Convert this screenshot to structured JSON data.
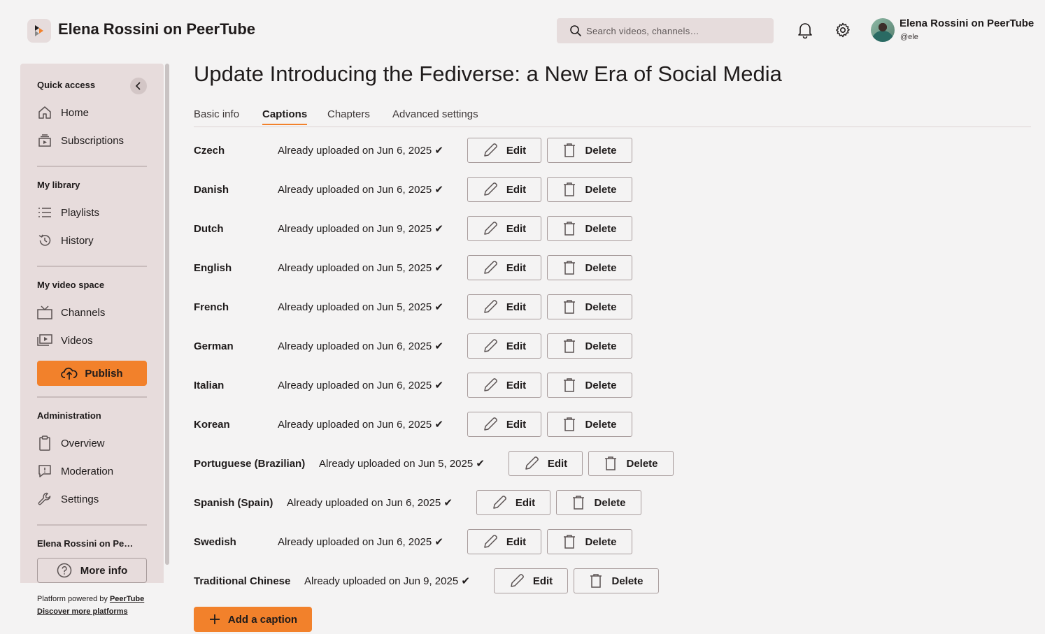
{
  "header": {
    "brand": "Elena Rossini on PeerTube",
    "search_placeholder": "Search videos, channels…",
    "user_name": "Elena Rossini on PeerTube",
    "user_handle": "@ele"
  },
  "sidebar": {
    "quick_access": "Quick access",
    "quick_items": [
      {
        "label": "Home",
        "icon": "home-icon"
      },
      {
        "label": "Subscriptions",
        "icon": "subscriptions-icon"
      }
    ],
    "my_library": "My library",
    "library_items": [
      {
        "label": "Playlists",
        "icon": "playlist-icon"
      },
      {
        "label": "History",
        "icon": "history-icon"
      }
    ],
    "my_video_space": "My video space",
    "space_items": [
      {
        "label": "Channels",
        "icon": "channel-icon"
      },
      {
        "label": "Videos",
        "icon": "videos-icon"
      }
    ],
    "publish": "Publish",
    "administration": "Administration",
    "admin_items": [
      {
        "label": "Overview",
        "icon": "clipboard-icon"
      },
      {
        "label": "Moderation",
        "icon": "moderation-icon"
      },
      {
        "label": "Settings",
        "icon": "wrench-icon"
      }
    ],
    "instance_title": "Elena Rossini on Pe…",
    "more_info": "More info",
    "powered_by": "Platform powered by ",
    "peertube_link": "PeerTube",
    "discover": "Discover more platforms"
  },
  "main": {
    "title": "Update Introducing the Fediverse: a New Era of Social Media",
    "tabs": [
      "Basic info",
      "Captions",
      "Chapters",
      "Advanced settings"
    ],
    "active_tab": "Captions",
    "edit_label": "Edit",
    "delete_label": "Delete",
    "add_caption": "Add a caption",
    "captions": [
      {
        "language": "Czech",
        "status": "Already uploaded on Jun 6, 2025 ✔"
      },
      {
        "language": "Danish",
        "status": "Already uploaded on Jun 6, 2025 ✔"
      },
      {
        "language": "Dutch",
        "status": "Already uploaded on Jun 9, 2025 ✔"
      },
      {
        "language": "English",
        "status": "Already uploaded on Jun 5, 2025 ✔"
      },
      {
        "language": "French",
        "status": "Already uploaded on Jun 5, 2025 ✔"
      },
      {
        "language": "German",
        "status": "Already uploaded on Jun 6, 2025 ✔"
      },
      {
        "language": "Italian",
        "status": "Already uploaded on Jun 6, 2025 ✔"
      },
      {
        "language": "Korean",
        "status": "Already uploaded on Jun 6, 2025 ✔"
      },
      {
        "language": "Portuguese (Brazilian)",
        "status": "Already uploaded on Jun 5, 2025 ✔"
      },
      {
        "language": "Spanish (Spain)",
        "status": "Already uploaded on Jun 6, 2025 ✔"
      },
      {
        "language": "Swedish",
        "status": "Already uploaded on Jun 6, 2025 ✔"
      },
      {
        "language": "Traditional Chinese",
        "status": "Already uploaded on Jun 9, 2025 ✔"
      }
    ]
  },
  "colors": {
    "accent": "#f2812b",
    "sidebar_bg": "#e7dcdc",
    "page_bg": "#f4f3f3"
  }
}
